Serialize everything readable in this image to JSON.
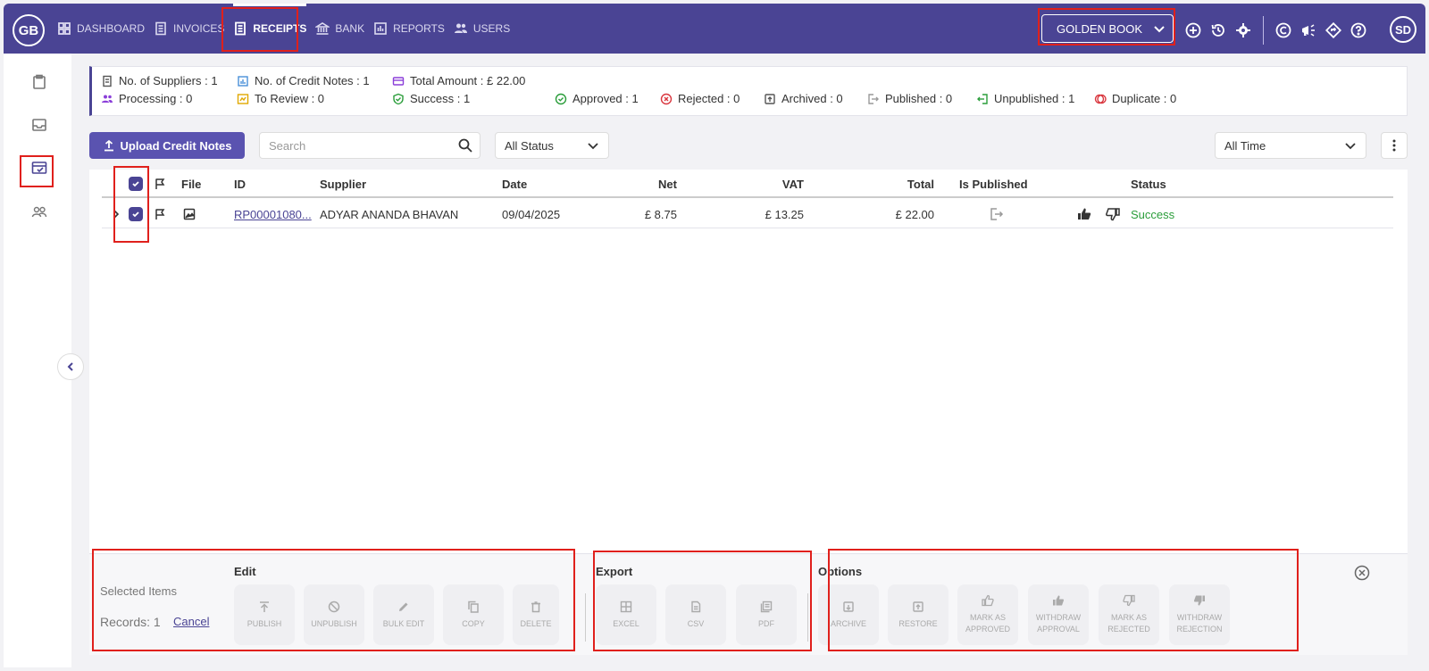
{
  "header": {
    "logo": "GB",
    "nav": [
      {
        "label": "DASHBOARD",
        "icon": "grid-icon"
      },
      {
        "label": "INVOICES",
        "icon": "invoice-icon"
      },
      {
        "label": "RECEIPTS",
        "icon": "receipt-icon",
        "active": true
      },
      {
        "label": "BANK",
        "icon": "bank-icon"
      },
      {
        "label": "REPORTS",
        "icon": "report-icon"
      },
      {
        "label": "USERS",
        "icon": "users-icon"
      }
    ],
    "company": "GOLDEN BOOK",
    "avatar": "SD"
  },
  "summary": {
    "suppliers": "No. of Suppliers : 1",
    "credit_notes": "No. of Credit Notes : 1",
    "total_amount": "Total Amount : £ 22.00",
    "processing": "Processing : 0",
    "to_review": "To Review : 0",
    "success": "Success : 1",
    "approved": "Approved : 1",
    "rejected": "Rejected : 0",
    "archived": "Archived : 0",
    "published": "Published : 0",
    "unpublished": "Unpublished : 1",
    "duplicate": "Duplicate : 0"
  },
  "toolbar": {
    "upload_label": "Upload Credit Notes",
    "search_placeholder": "Search",
    "status_filter": "All Status",
    "time_filter": "All Time"
  },
  "table": {
    "headers": {
      "file": "File",
      "id": "ID",
      "supplier": "Supplier",
      "date": "Date",
      "net": "Net",
      "vat": "VAT",
      "total": "Total",
      "is_published": "Is Published",
      "status": "Status"
    },
    "rows": [
      {
        "id": "RP00001080...",
        "supplier": "ADYAR ANANDA BHAVAN",
        "date": "09/04/2025",
        "net": "£ 8.75",
        "vat": "£ 13.25",
        "total": "£ 22.00",
        "status": "Success"
      }
    ]
  },
  "bottom": {
    "selected_items": "Selected Items",
    "records": "Records: 1",
    "cancel": "Cancel",
    "edit_title": "Edit",
    "export_title": "Export",
    "options_title": "Options",
    "edit_actions": [
      "PUBLISH",
      "UNPUBLISH",
      "BULK EDIT",
      "COPY",
      "DELETE"
    ],
    "export_actions": [
      "EXCEL",
      "CSV",
      "PDF"
    ],
    "option_actions": [
      [
        "ARCHIVE"
      ],
      [
        "RESTORE"
      ],
      [
        "MARK AS",
        "APPROVED"
      ],
      [
        "WITHDRAW",
        "APPROVAL"
      ],
      [
        "MARK AS",
        "REJECTED"
      ],
      [
        "WITHDRAW",
        "REJECTION"
      ]
    ]
  }
}
